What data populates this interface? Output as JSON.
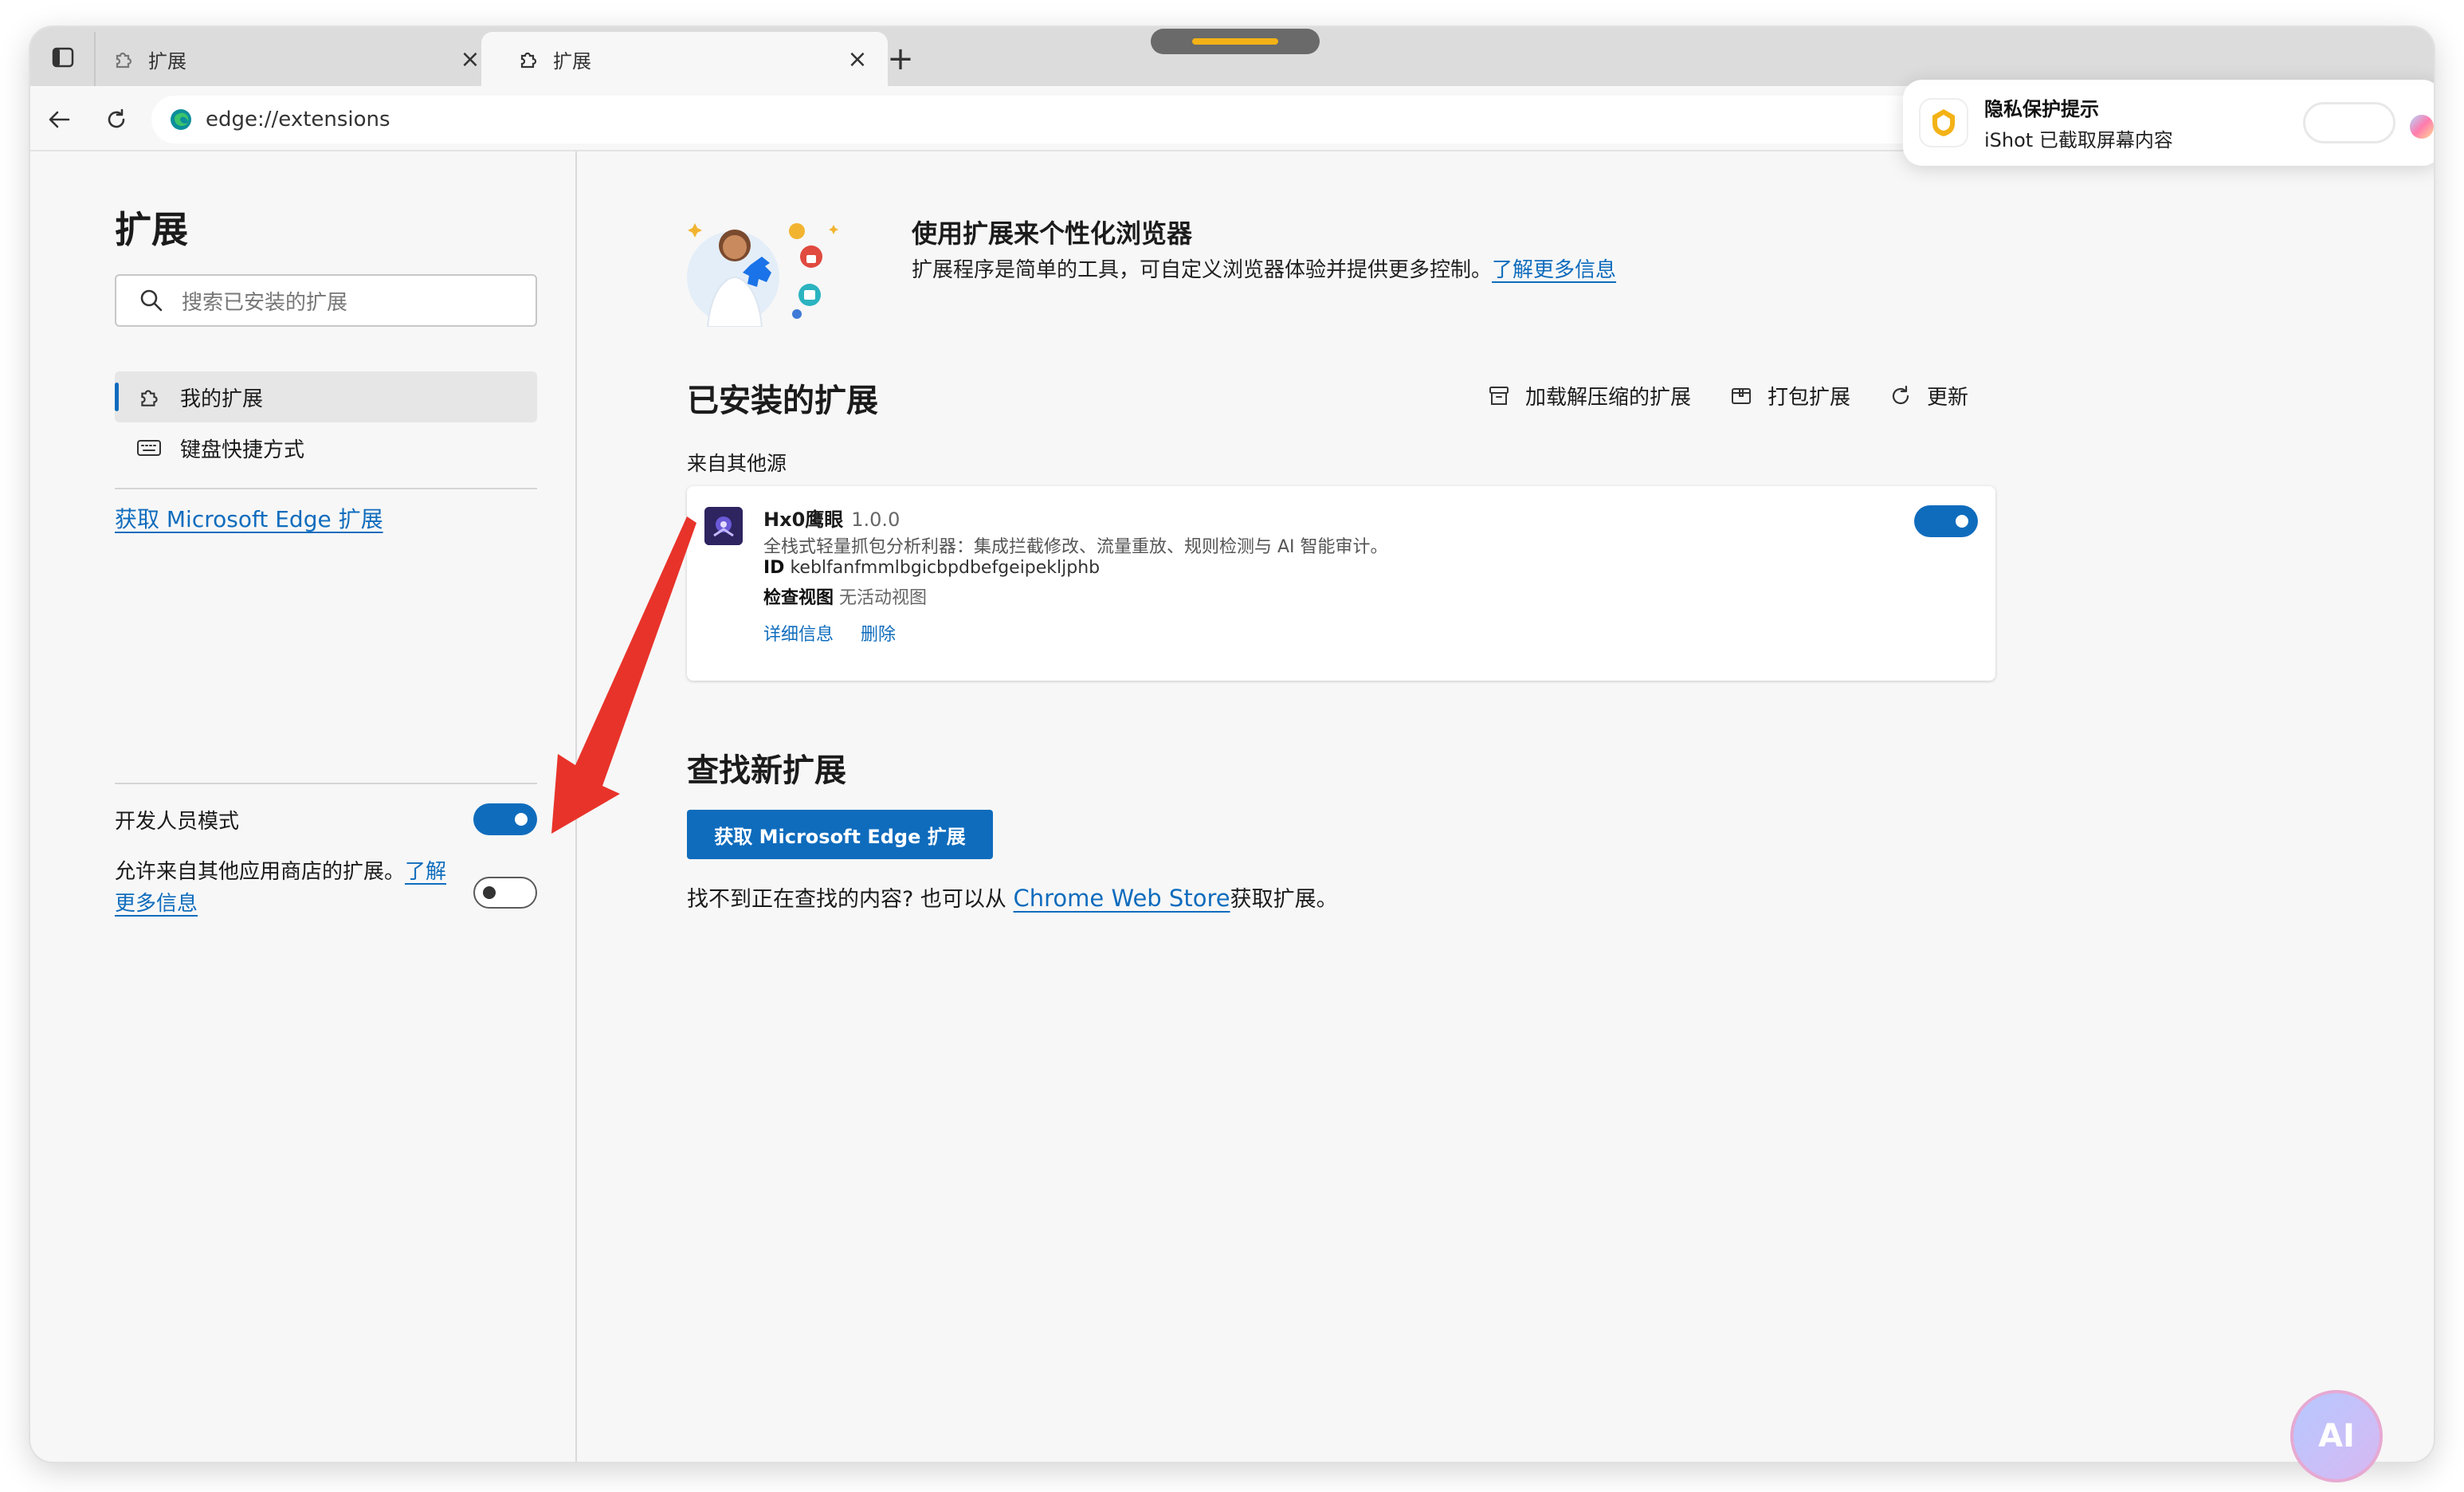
{
  "browser": {
    "tabs": [
      {
        "label": "扩展"
      },
      {
        "label": "扩展"
      }
    ],
    "address": "edge://extensions"
  },
  "notification": {
    "title": "隐私保护提示",
    "body": "iShot 已截取屏幕内容"
  },
  "sidebar": {
    "title": "扩展",
    "search_placeholder": "搜索已安装的扩展",
    "items": [
      {
        "label": "我的扩展",
        "icon": "puzzle-icon"
      },
      {
        "label": "键盘快捷方式",
        "icon": "keyboard-icon"
      }
    ],
    "get_link": "获取 Microsoft Edge 扩展",
    "developer_mode": "开发人员模式",
    "developer_mode_on": true,
    "allow_other_stores": "允许来自其他应用商店的扩展。",
    "learn_more": "了解更多信息",
    "allow_other_stores_on": false
  },
  "main": {
    "hero_title": "使用扩展来个性化浏览器",
    "hero_desc": "扩展程序是简单的工具，可自定义浏览器体验并提供更多控制。",
    "hero_learn_more": "了解更多信息",
    "installed_title": "已安装的扩展",
    "actions": [
      {
        "label": "加载解压缩的扩展",
        "icon": "archive-icon"
      },
      {
        "label": "打包扩展",
        "icon": "package-icon"
      },
      {
        "label": "更新",
        "icon": "refresh-icon"
      }
    ],
    "source_label": "来自其他源",
    "extension": {
      "name": "Hx0鹰眼",
      "version": "1.0.0",
      "description": "全栈式轻量抓包分析利器：集成拦截修改、流量重放、规则检测与 AI 智能审计。",
      "id_label": "ID",
      "id": "keblfanfmmlbgicbpdbefgeipekljphb",
      "inspect_label": "检查视图",
      "inspect_value": "无活动视图",
      "details_link": "详细信息",
      "remove_link": "删除",
      "enabled": true
    },
    "find_title": "查找新扩展",
    "get_button": "获取 Microsoft Edge 扩展",
    "find_text_before": "找不到正在查找的内容? 也可以从",
    "chrome_store": "Chrome Web Store",
    "find_text_after": "获取扩展。"
  },
  "ai_badge": "AI",
  "colors": {
    "accent": "#0f6cbd",
    "arrow": "#e8332a"
  }
}
